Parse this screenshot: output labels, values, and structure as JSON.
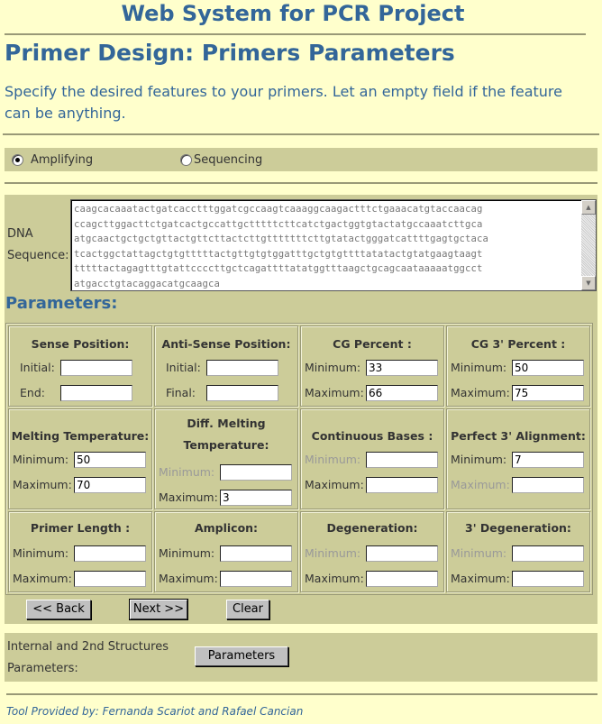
{
  "header": {
    "site_title": "Web System for PCR Project",
    "page_title": "Primer Design: Primers Parameters",
    "intro_text": "Specify the desired features to your primers. Let an empty field if the feature can be anything."
  },
  "mode": {
    "options": [
      {
        "label": "Amplifying",
        "checked": true
      },
      {
        "label": "Sequencing",
        "checked": false
      }
    ]
  },
  "dna": {
    "label_line1": "DNA",
    "label_line2": "Sequence:",
    "value": "caagcacaaatactgatcacctttggatcgccaagtcaaaggcaagactttctgaaacatgtaccaacag\nccagcttggacttctgatcactgccattgctttttcttcatctgactggtgtactatgccaaatcttgca\natgcaactgctgctgttactgttcttactcttgtttttttcttgtatactgggatcattttgagtgctaca\ntcactggctattagctgtgtttttactgttgtgtggatttgctgtgttttatatactgtatgaagtaagt\ntttttactagagtttgtattccccttgctcagattttatatggtttaagctgcagcaataaaaatggcct\natgacctgtacaggacatgcaagca"
  },
  "parameters": {
    "heading": "Parameters:",
    "cells": [
      {
        "title": "Sense Position:",
        "fields": [
          {
            "label": "Initial:",
            "value": "",
            "disabled": false
          },
          {
            "label": "End:",
            "value": "",
            "disabled": false
          }
        ]
      },
      {
        "title": "Anti-Sense Position:",
        "fields": [
          {
            "label": "Initial:",
            "value": "",
            "disabled": false
          },
          {
            "label": "Final:",
            "value": "",
            "disabled": false
          }
        ]
      },
      {
        "title": "CG Percent :",
        "fields": [
          {
            "label": "Minimum:",
            "value": "33",
            "disabled": false
          },
          {
            "label": "Maximum:",
            "value": "66",
            "disabled": false
          }
        ]
      },
      {
        "title": "CG 3' Percent :",
        "fields": [
          {
            "label": "Minimum:",
            "value": "50",
            "disabled": false
          },
          {
            "label": "Maximum:",
            "value": "75",
            "disabled": false
          }
        ]
      },
      {
        "title": "Melting Temperature:",
        "fields": [
          {
            "label": "Minimum:",
            "value": "50",
            "disabled": false
          },
          {
            "label": "Maximum:",
            "value": "70",
            "disabled": false
          }
        ]
      },
      {
        "title_line1": "Diff. Melting",
        "title_line2": "Temperature:",
        "fields": [
          {
            "label": "Minimum:",
            "value": "",
            "disabled": true
          },
          {
            "label": "Maximum:",
            "value": "3",
            "disabled": false
          }
        ]
      },
      {
        "title": "Continuous Bases :",
        "fields": [
          {
            "label": "Minimum:",
            "value": "",
            "disabled": true
          },
          {
            "label": "Maximum:",
            "value": "",
            "disabled": false
          }
        ]
      },
      {
        "title": "Perfect 3' Alignment:",
        "fields": [
          {
            "label": "Minimum:",
            "value": "7",
            "disabled": false
          },
          {
            "label": "Maximum:",
            "value": "",
            "disabled": true
          }
        ]
      },
      {
        "title": "Primer Length :",
        "fields": [
          {
            "label": "Minimum:",
            "value": "",
            "disabled": false
          },
          {
            "label": "Maximum:",
            "value": "",
            "disabled": false
          }
        ]
      },
      {
        "title": "Amplicon:",
        "fields": [
          {
            "label": "Minimum:",
            "value": "",
            "disabled": false
          },
          {
            "label": "Maximum:",
            "value": "",
            "disabled": false
          }
        ]
      },
      {
        "title": "Degeneration:",
        "fields": [
          {
            "label": "Minimum:",
            "value": "",
            "disabled": true
          },
          {
            "label": "Maximum:",
            "value": "",
            "disabled": false
          }
        ]
      },
      {
        "title": "3' Degeneration:",
        "fields": [
          {
            "label": "Minimum:",
            "value": "",
            "disabled": true
          },
          {
            "label": "Maximum:",
            "value": "",
            "disabled": false
          }
        ]
      }
    ]
  },
  "buttons": {
    "back": "<< Back",
    "next": "Next >>",
    "clear": "Clear",
    "parameters": "Parameters"
  },
  "internal": {
    "label_line1": "Internal and 2nd Structures",
    "label_line2": "Parameters:"
  },
  "footer": {
    "credit": "Tool Provided by: Fernanda Scariot and Rafael Cancian"
  }
}
